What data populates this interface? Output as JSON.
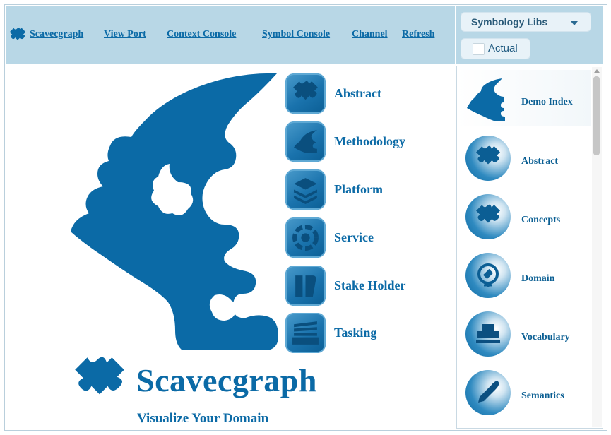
{
  "nav": {
    "brand": "Scavecgraph",
    "links": [
      "View Port",
      "Context Console",
      "Symbol Console",
      "Channel",
      "Refresh"
    ]
  },
  "panel": {
    "library_select": "Symbology Libs",
    "actual_label": "Actual"
  },
  "sidebar": {
    "items": [
      {
        "label": "Demo Index",
        "icon": "head-profile-icon"
      },
      {
        "label": "Abstract",
        "icon": "puzzle-icon"
      },
      {
        "label": "Concepts",
        "icon": "puzzle-icon"
      },
      {
        "label": "Domain",
        "icon": "globe-icon"
      },
      {
        "label": "Vocabulary",
        "icon": "stamp-icon"
      },
      {
        "label": "Semantics",
        "icon": "pen-icon"
      }
    ]
  },
  "menu": {
    "items": [
      {
        "label": "Abstract",
        "icon": "puzzle-icon"
      },
      {
        "label": "Methodology",
        "icon": "head-profile-icon"
      },
      {
        "label": "Platform",
        "icon": "layers-icon"
      },
      {
        "label": "Service",
        "icon": "gear-icon"
      },
      {
        "label": "Stake Holder",
        "icon": "pillars-icon"
      },
      {
        "label": "Tasking",
        "icon": "tray-icon"
      }
    ]
  },
  "hero": {
    "title": "Scavecgraph",
    "tagline": "Visualize Your Domain"
  },
  "colors": {
    "brand_blue": "#0b6aa6",
    "bar_bg": "#b8d7e6"
  }
}
